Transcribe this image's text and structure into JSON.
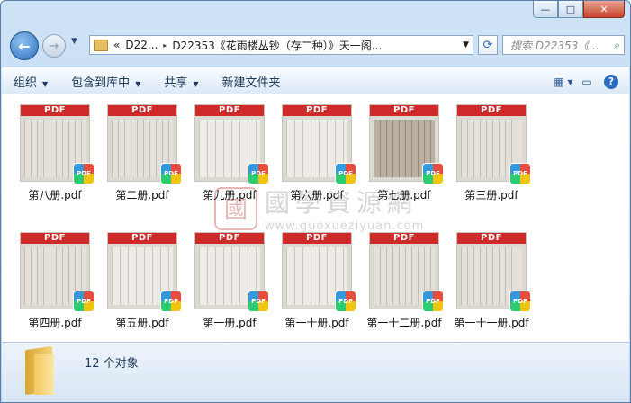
{
  "window": {
    "caption_buttons": {
      "minimize": "—",
      "maximize": "□",
      "close": "✕"
    }
  },
  "nav": {
    "back_glyph": "←",
    "forward_glyph": "→",
    "history_glyph": "▼",
    "address": {
      "prefix": "«",
      "segments": [
        "D22...",
        "D22353《花雨楼丛钞（存二种）》天一阁..."
      ],
      "separator": "▸",
      "dropdown": "▼"
    },
    "refresh_glyph": "⟳",
    "search_placeholder": "搜索 D22353《...",
    "search_glyph": "⌕"
  },
  "toolbar": {
    "items": [
      {
        "label": "组织",
        "caret": "▼"
      },
      {
        "label": "包含到库中",
        "caret": "▼"
      },
      {
        "label": "共享",
        "caret": "▼"
      },
      {
        "label": "新建文件夹",
        "caret": ""
      }
    ],
    "view_icon": "view-options-icon",
    "pane_icon": "preview-pane-icon",
    "help": "?"
  },
  "files": [
    {
      "name": "第八册.pdf",
      "band": "PDF",
      "badge": "PDF",
      "tone": "normal"
    },
    {
      "name": "第二册.pdf",
      "band": "PDF",
      "badge": "PDF",
      "tone": "normal"
    },
    {
      "name": "第九册.pdf",
      "band": "PDF",
      "badge": "PDF",
      "tone": "light"
    },
    {
      "name": "第六册.pdf",
      "band": "PDF",
      "badge": "PDF",
      "tone": "light"
    },
    {
      "name": "第七册.pdf",
      "band": "PDF",
      "badge": "PDF",
      "tone": "dark"
    },
    {
      "name": "第三册.pdf",
      "band": "PDF",
      "badge": "PDF",
      "tone": "normal"
    },
    {
      "name": "第四册.pdf",
      "band": "PDF",
      "badge": "PDF",
      "tone": "normal"
    },
    {
      "name": "第五册.pdf",
      "band": "PDF",
      "badge": "PDF",
      "tone": "light"
    },
    {
      "name": "第一册.pdf",
      "band": "PDF",
      "badge": "PDF",
      "tone": "light"
    },
    {
      "name": "第一十册.pdf",
      "band": "PDF",
      "badge": "PDF",
      "tone": "light"
    },
    {
      "name": "第一十二册.pdf",
      "band": "PDF",
      "badge": "PDF",
      "tone": "normal"
    },
    {
      "name": "第一十一册.pdf",
      "band": "PDF",
      "badge": "PDF",
      "tone": "normal"
    }
  ],
  "watermark": {
    "seal": "國",
    "title": "國學資源網",
    "url": "www.guoxueziyuan.com"
  },
  "status": {
    "count": "12 个对象"
  }
}
